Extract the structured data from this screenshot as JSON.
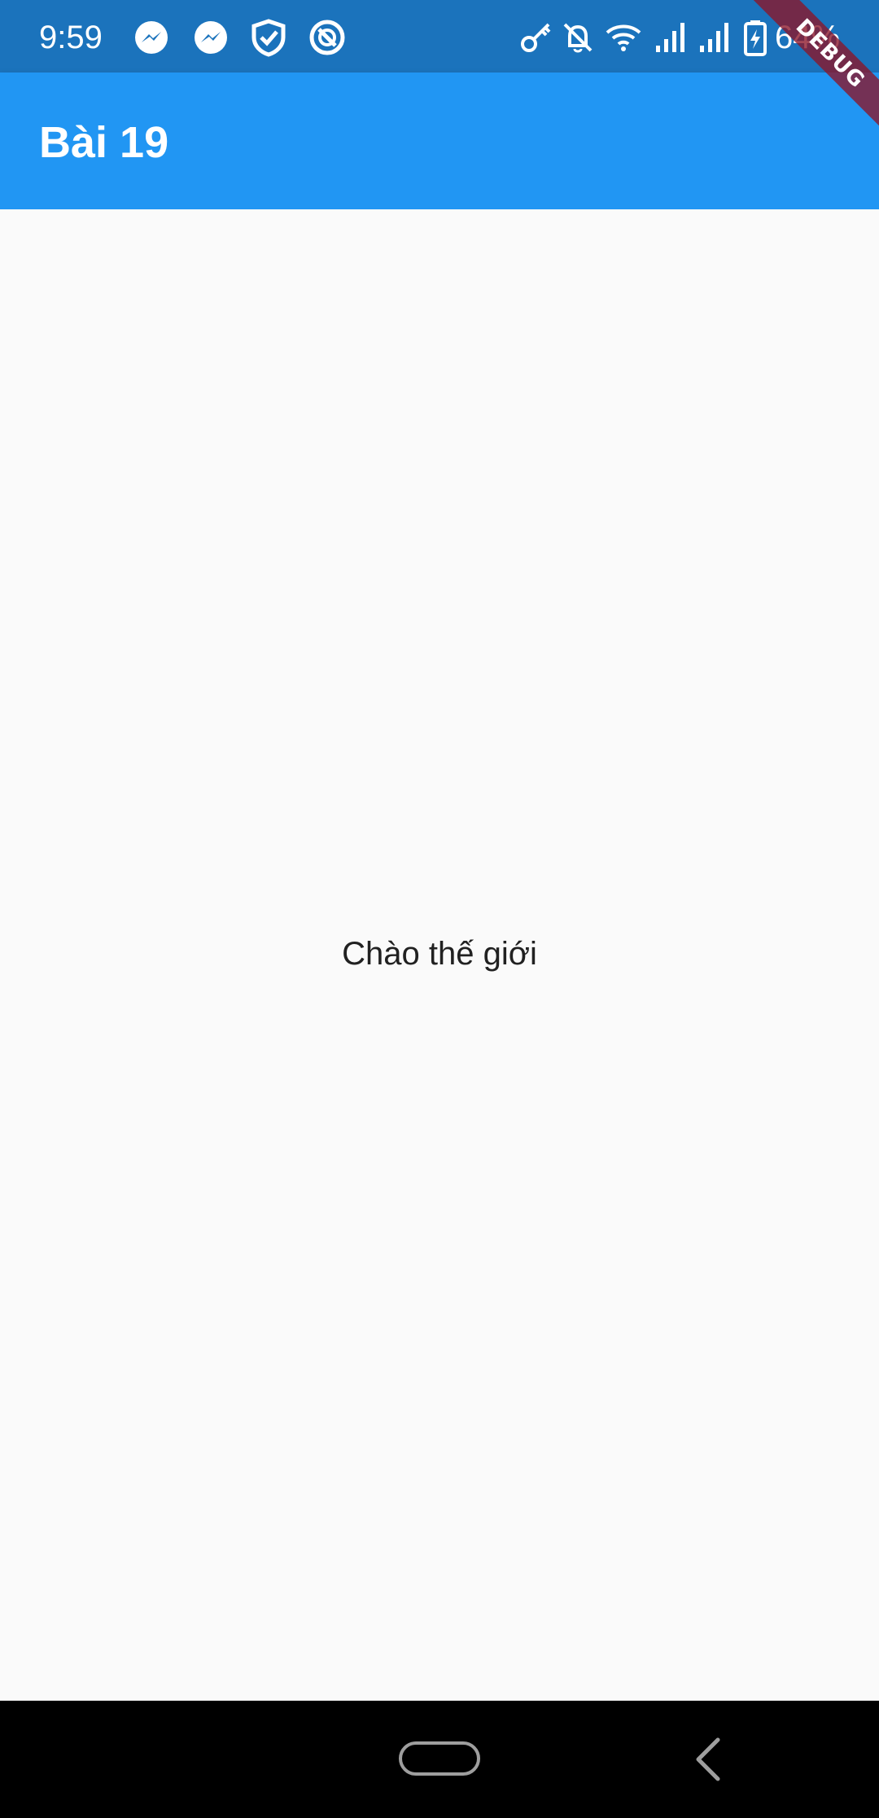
{
  "status_bar": {
    "time": "9:59",
    "battery_percent": "64%",
    "background_color": "#1b73bc",
    "left_icons": [
      "messenger-icon",
      "messenger-icon",
      "shield-check-icon",
      "data-saver-icon"
    ],
    "right_icons": [
      "key-icon",
      "bell-off-icon",
      "wifi-icon",
      "signal-icon",
      "signal-icon",
      "battery-charging-icon"
    ]
  },
  "debug_banner": {
    "label": "DEBUG"
  },
  "app_bar": {
    "title": "Bài 19",
    "color": "#2196f3"
  },
  "body": {
    "text": "Chào thế giới",
    "background_color": "#fafafa"
  },
  "nav_bar": {
    "icons": [
      "home-pill-icon",
      "back-icon"
    ]
  }
}
